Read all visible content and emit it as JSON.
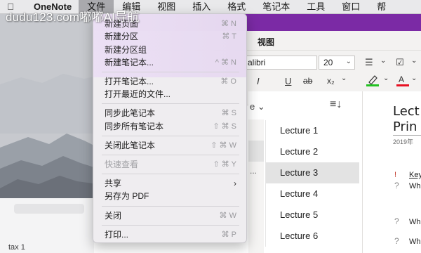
{
  "watermark": "dudu123.com嘟嘟AI导航",
  "menubar": {
    "app": "OneNote",
    "items": [
      "文件",
      "编辑",
      "视图",
      "插入",
      "格式",
      "笔记本",
      "工具",
      "窗口",
      "帮"
    ]
  },
  "ribbon": {
    "tab_view": "视图",
    "font": "alibri",
    "size": "20"
  },
  "file_menu": {
    "items": [
      {
        "label": "新建页面",
        "shortcut": "⌘ N"
      },
      {
        "label": "新建分区",
        "shortcut": "⌘ T"
      },
      {
        "label": "新建分区组",
        "shortcut": ""
      },
      {
        "label": "新建笔记本...",
        "shortcut": "^ ⌘ N"
      },
      {
        "label": "打开笔记本...",
        "shortcut": "⌘ O"
      },
      {
        "label": "打开最近的文件...",
        "shortcut": ""
      },
      {
        "label": "同步此笔记本",
        "shortcut": "⌘ S"
      },
      {
        "label": "同步所有笔记本",
        "shortcut": "⇧ ⌘ S"
      },
      {
        "label": "关闭此笔记本",
        "shortcut": "⇧ ⌘ W"
      },
      {
        "label": "快速查看",
        "shortcut": "⇧ ⌘ Y"
      },
      {
        "label": "共享",
        "shortcut": ""
      },
      {
        "label": "另存为 PDF",
        "shortcut": ""
      },
      {
        "label": "关闭",
        "shortcut": "⌘ W"
      },
      {
        "label": "打印...",
        "shortcut": "⌘ P"
      }
    ]
  },
  "pages": [
    "Lecture 1",
    "Lecture 2",
    "Lecture 3",
    "Lecture 4",
    "Lecture 5",
    "Lecture 6"
  ],
  "selected_page": "Lecture 3",
  "sort_label": "e",
  "section_dots": "...",
  "note": {
    "title_1": "Lect",
    "title_2": "Prin",
    "date": "2019年",
    "lines": [
      "Key",
      "Wh",
      "Wh",
      "Wh"
    ]
  },
  "background": {
    "tax_label": "tax 1"
  },
  "colors": {
    "onenote_purple": "#7b2aa5",
    "highlight_green": "#22c222",
    "font_red": "#e81123"
  }
}
